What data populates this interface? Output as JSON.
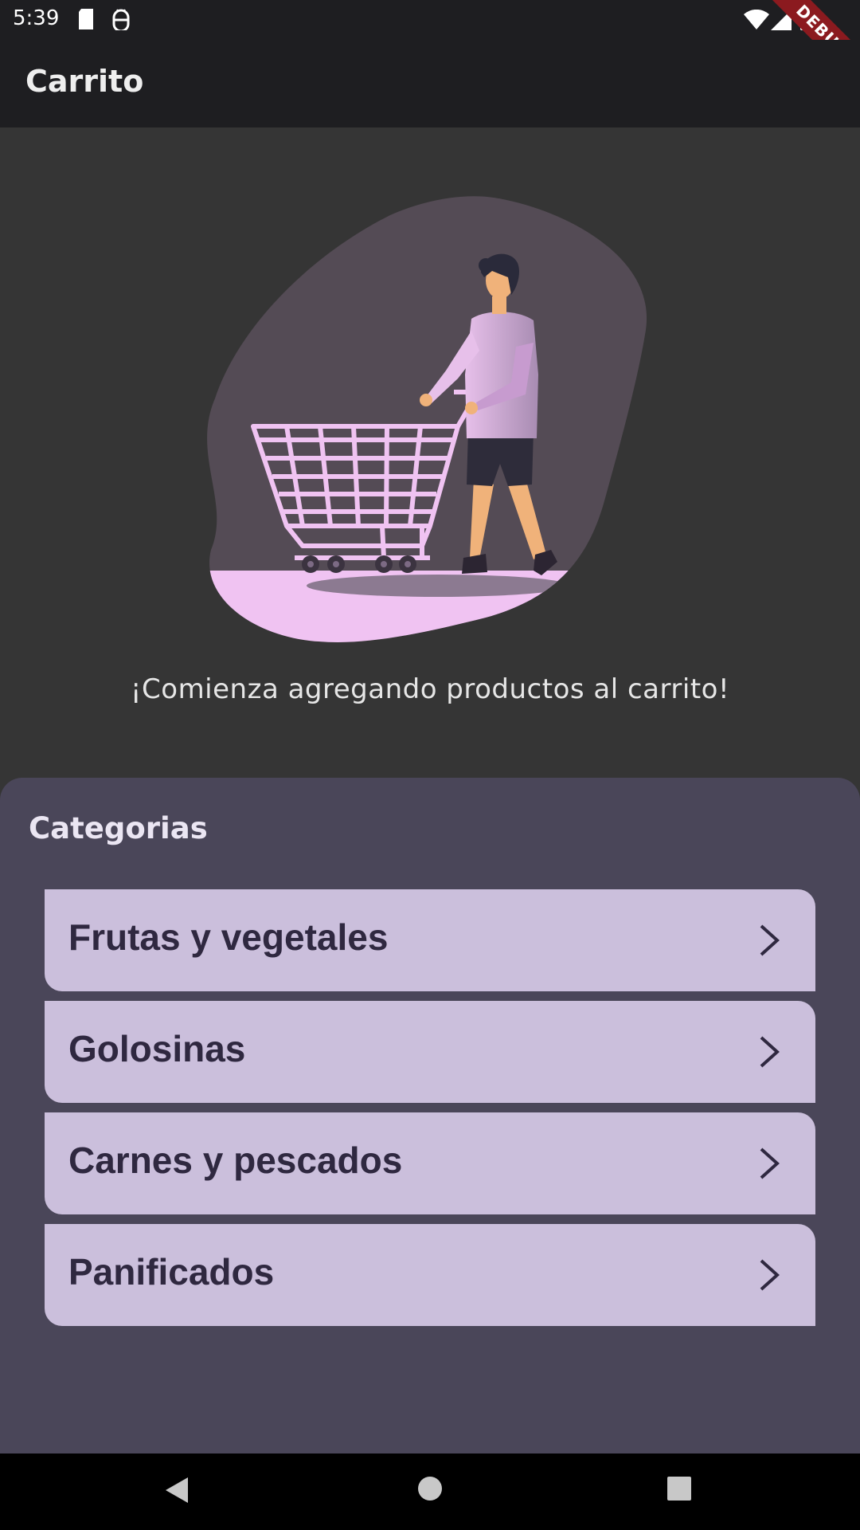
{
  "status_bar": {
    "time": "5:39",
    "debug_label": "DEBUG",
    "icons": [
      "sd-card-icon",
      "android-debug-icon",
      "wifi-icon",
      "signal-icon",
      "battery-icon"
    ]
  },
  "app_bar": {
    "title": "Carrito"
  },
  "empty_state": {
    "illustration": "shopping-cart-person-illustration",
    "message": "¡Comienza agregando productos al carrito!"
  },
  "categories": {
    "title": "Categorias",
    "items": [
      {
        "label": "Frutas y vegetales"
      },
      {
        "label": "Golosinas"
      },
      {
        "label": "Carnes y pescados"
      },
      {
        "label": "Panificados"
      }
    ]
  },
  "colors": {
    "app_bar_bg": "#1e1e21",
    "page_bg": "#353535",
    "panel_bg": "#4a4659",
    "card_bg": "#cbbfdc",
    "card_text": "#2f2840",
    "accent_pink": "#f0c3f2"
  },
  "nav_bar": {
    "icons": [
      "back-icon",
      "home-icon",
      "recents-icon"
    ]
  }
}
